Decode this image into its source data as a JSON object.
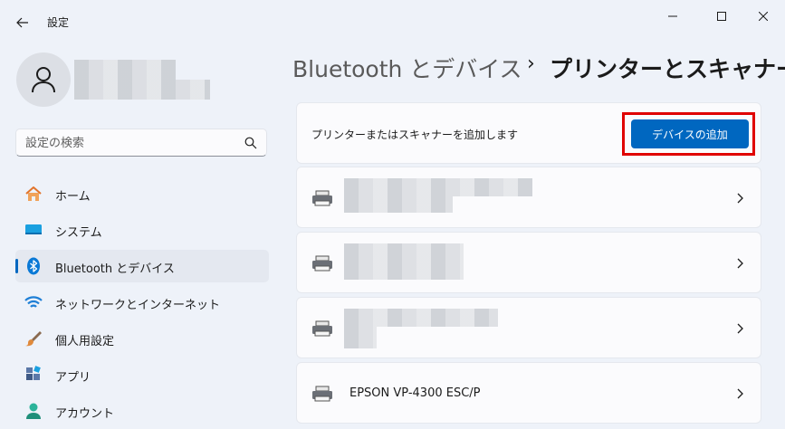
{
  "window": {
    "title": "設定",
    "back_icon": "back-arrow-icon"
  },
  "user": {
    "avatar_icon": "person-icon"
  },
  "search": {
    "placeholder": "設定の検索",
    "value": ""
  },
  "sidebar": {
    "items": [
      {
        "label": "ホーム",
        "icon": "home-icon",
        "active": false
      },
      {
        "label": "システム",
        "icon": "system-icon",
        "active": false
      },
      {
        "label": "Bluetooth とデバイス",
        "icon": "bluetooth-icon",
        "active": true
      },
      {
        "label": "ネットワークとインターネット",
        "icon": "wifi-icon",
        "active": false
      },
      {
        "label": "個人用設定",
        "icon": "brush-icon",
        "active": false
      },
      {
        "label": "アプリ",
        "icon": "apps-icon",
        "active": false
      },
      {
        "label": "アカウント",
        "icon": "account-icon",
        "active": false
      }
    ]
  },
  "breadcrumb": {
    "parent": "Bluetooth とデバイス",
    "separator": "›",
    "current": "プリンターとスキャナー"
  },
  "add_device": {
    "label": "プリンターまたはスキャナーを追加します",
    "button": "デバイスの追加"
  },
  "printers": [
    {
      "name": "",
      "redacted": true
    },
    {
      "name": "",
      "redacted": true
    },
    {
      "name": "",
      "redacted": true
    },
    {
      "name": "EPSON VP-4300 ESC/P",
      "redacted": false
    }
  ],
  "colors": {
    "accent": "#0067c0",
    "highlight": "#e00000",
    "background": "#eef2f9"
  }
}
